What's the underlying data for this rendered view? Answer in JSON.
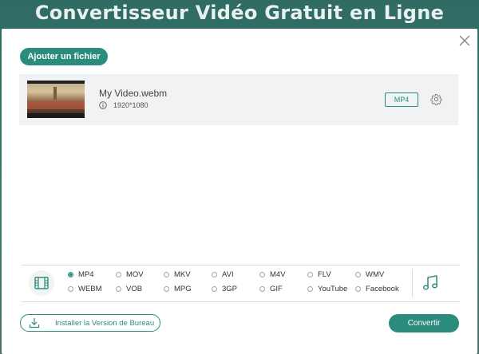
{
  "background": {
    "title": "Convertisseur Vidéo Gratuit en Ligne"
  },
  "dialog": {
    "add_button_label": "Ajouter un fichier",
    "file": {
      "name": "My Video.webm",
      "resolution": "1920*1080",
      "format_badge": "MP4"
    },
    "formats": [
      {
        "label": "MP4",
        "selected": true
      },
      {
        "label": "MOV",
        "selected": false
      },
      {
        "label": "MKV",
        "selected": false
      },
      {
        "label": "AVI",
        "selected": false
      },
      {
        "label": "M4V",
        "selected": false
      },
      {
        "label": "FLV",
        "selected": false
      },
      {
        "label": "WMV",
        "selected": false
      },
      {
        "label": "WEBM",
        "selected": false
      },
      {
        "label": "VOB",
        "selected": false
      },
      {
        "label": "MPG",
        "selected": false
      },
      {
        "label": "3GP",
        "selected": false
      },
      {
        "label": "GIF",
        "selected": false
      },
      {
        "label": "YouTube",
        "selected": false
      },
      {
        "label": "Facebook",
        "selected": false
      }
    ],
    "install_button_label": "Installer la Version de Bureau",
    "convert_button_label": "Convertir"
  },
  "icons": {
    "close": "close-icon",
    "info": "info-icon",
    "settings": "gear-icon",
    "video_tab": "film-icon",
    "audio_tab": "music-note-icon",
    "download": "download-icon"
  },
  "colors": {
    "accent": "#2b8c7d",
    "row_bg": "#f1f2f3"
  }
}
